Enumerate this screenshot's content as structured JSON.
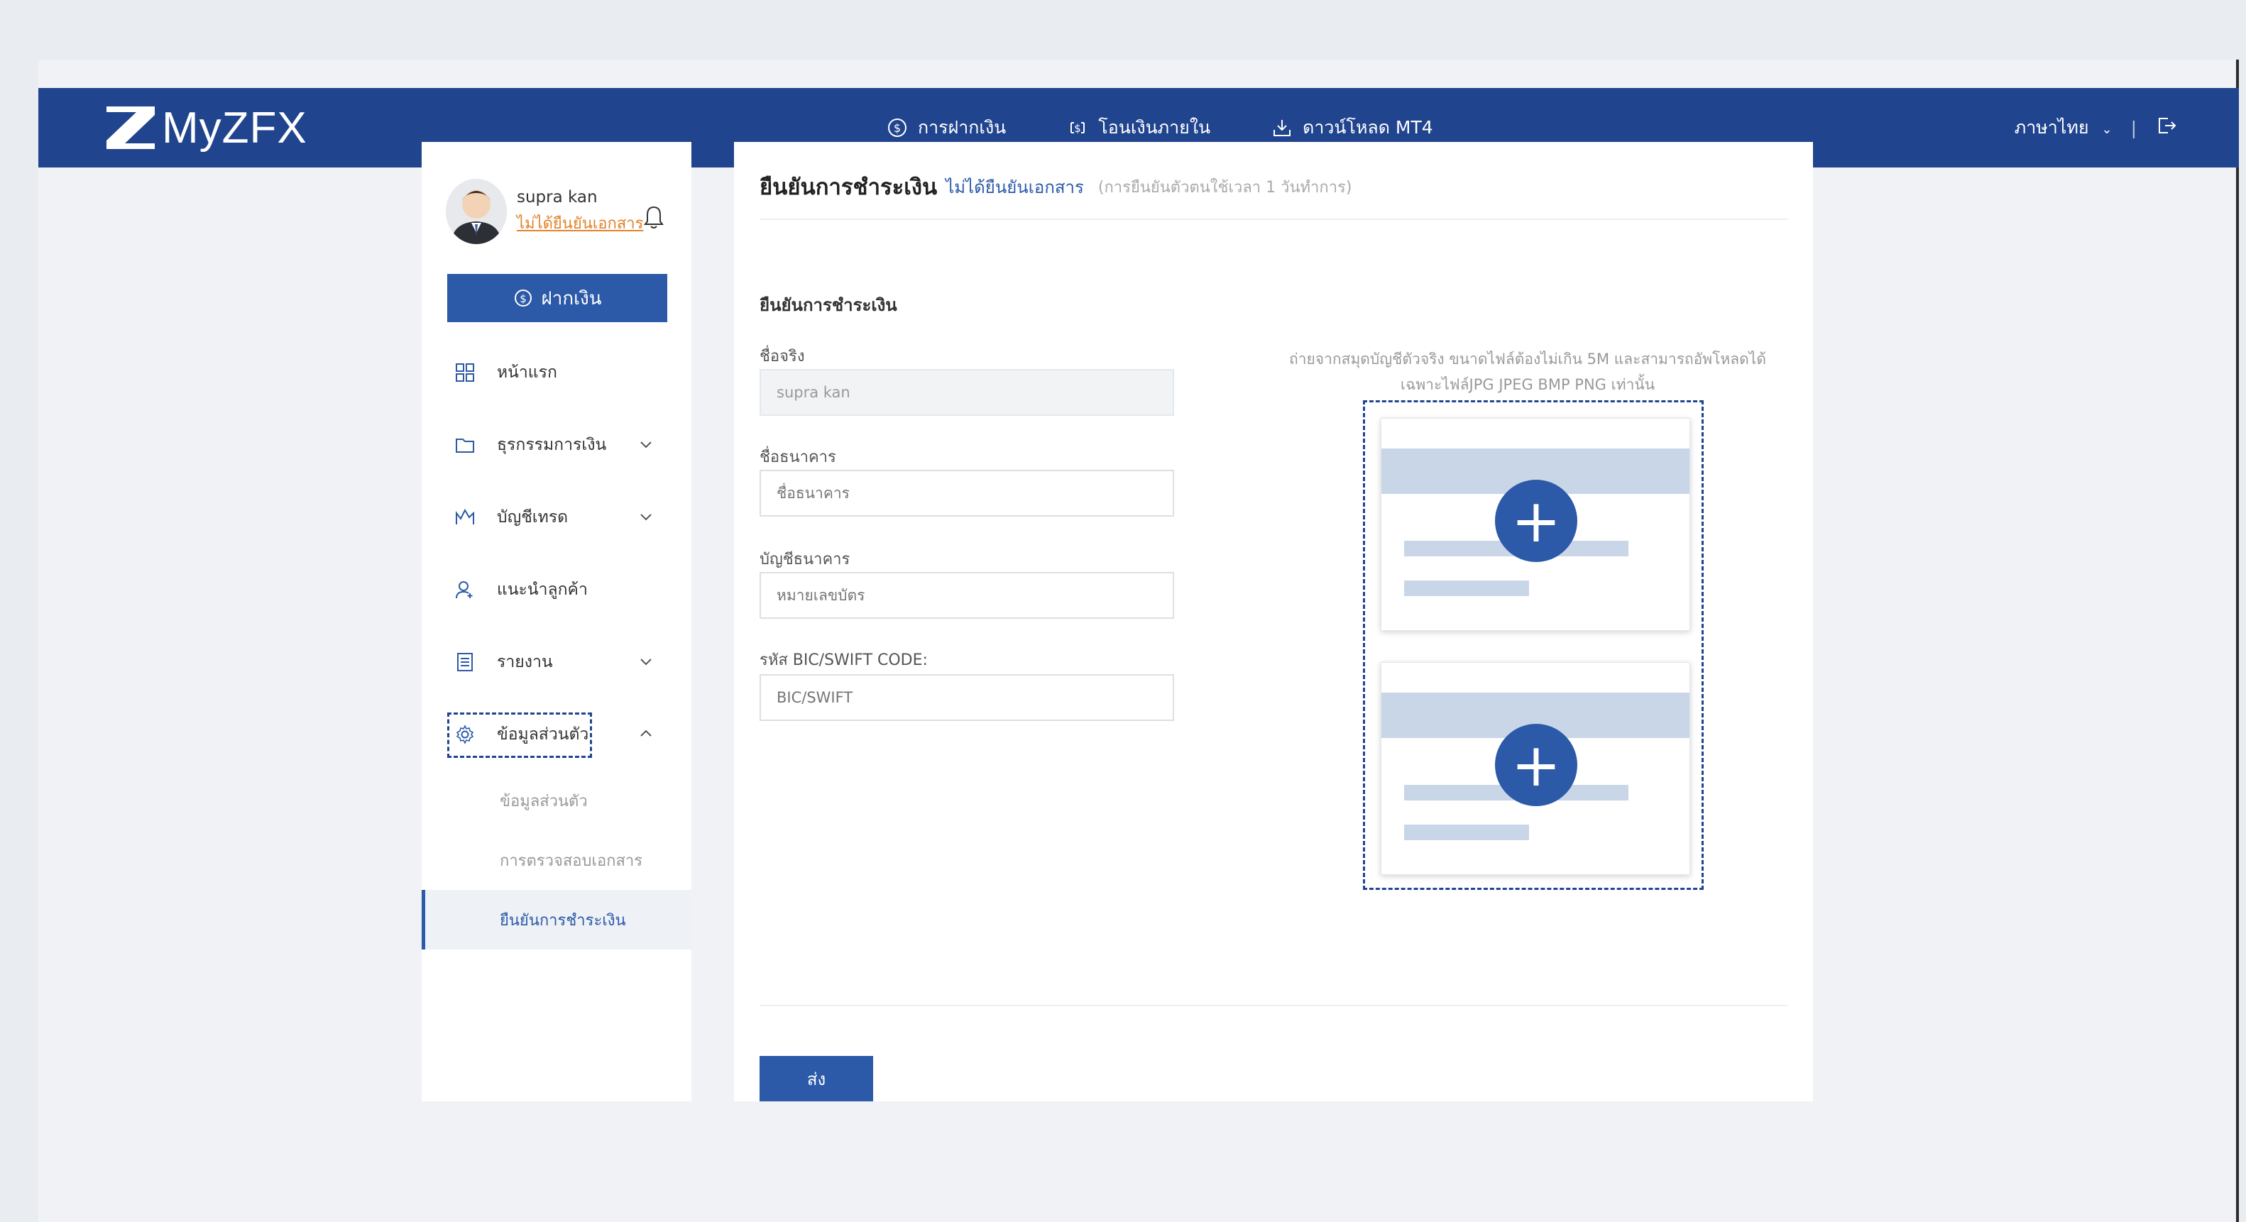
{
  "header": {
    "logo_text": "MyZFX",
    "nav": [
      {
        "label": "การฝากเงิน",
        "icon": "dollar-circle-icon"
      },
      {
        "label": "โอนเงินภายใน",
        "icon": "transfer-icon"
      },
      {
        "label": "ดาวน์โหลด MT4",
        "icon": "download-icon"
      }
    ],
    "language": "ภาษาไทย",
    "separator": "|",
    "logout_icon": "logout-icon"
  },
  "sidebar": {
    "user_name": "supra kan",
    "user_status": "ไม่ได้ยืนยันเอกสาร",
    "deposit_label": "ฝากเงิน",
    "menu": [
      {
        "label": "หน้าแรก",
        "icon": "dashboard-icon"
      },
      {
        "label": "ธุรกรรมการเงิน",
        "icon": "folder-icon"
      },
      {
        "label": "บัญชีเทรด",
        "icon": "chart-icon"
      },
      {
        "label": "แนะนำลูกค้า",
        "icon": "user-add-icon"
      },
      {
        "label": "รายงาน",
        "icon": "report-icon"
      },
      {
        "label": "ข้อมูลส่วนตัว",
        "icon": "gear-icon"
      }
    ],
    "submenu": [
      {
        "label": "ข้อมูลส่วนตัว"
      },
      {
        "label": "การตรวจสอบเอกสาร"
      },
      {
        "label": "ยืนยันการชำระเงิน"
      }
    ]
  },
  "main": {
    "title": "ยืนยันการชำระเงิน",
    "status_link": "ไม่ได้ยืนยันเอกสาร",
    "note": "(การยืนยันตัวตนใช้เวลา 1 วันทำการ)",
    "section_title": "ยืนยันการชำระเงิน",
    "fields": [
      {
        "label": "ชื่อจริง",
        "value": "supra kan",
        "placeholder": ""
      },
      {
        "label": "ชื่อธนาคาร",
        "value": "",
        "placeholder": "ชื่อธนาคาร"
      },
      {
        "label": "บัญชีธนาคาร",
        "value": "",
        "placeholder": "หมายเลขบัตร"
      },
      {
        "label": "รหัส BIC/SWIFT CODE:",
        "value": "",
        "placeholder": "BIC/SWIFT"
      }
    ],
    "upload_note_line1": "ถ่ายจากสมุดบัญชีตัวจริง ขนาดไฟล์ต้องไม่เกิน 5M และสามารถอัพโหลดได้",
    "upload_note_line2": "เฉพาะไฟล์JPG JPEG BMP PNG เท่านั้น",
    "upload_plus": "+",
    "submit_label": "ส่ง"
  },
  "colors": {
    "header_bg": "#21448f",
    "primary": "#2c5aa8",
    "accent_orange": "#e2832b",
    "placeholder_band": "#c9d6e8"
  }
}
